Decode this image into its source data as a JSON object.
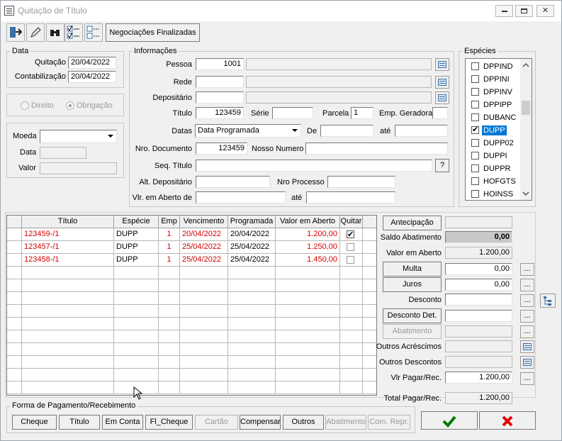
{
  "window": {
    "title": "Quitação de Título",
    "min": "▭",
    "max": "▭",
    "close": "✕"
  },
  "toolbar": {
    "negociacoes_label": "Negociações Finalizadas"
  },
  "data_group": {
    "title": "Data",
    "quitacao_label": "Quitação",
    "quitacao_value": "20/04/2022",
    "contabilizacao_label": "Contabilização",
    "contabilizacao_value": "20/04/2022"
  },
  "direito_group": {
    "direito_label": "Direito",
    "obrigacao_label": "Obrigação"
  },
  "moeda_group": {
    "moeda_label": "Moeda",
    "data_label": "Data",
    "valor_label": "Valor"
  },
  "informacoes": {
    "title": "Informações",
    "pessoa_label": "Pessoa",
    "pessoa_value": "1001",
    "rede_label": "Rede",
    "depositario_label": "Depositário",
    "titulo_label": "Título",
    "titulo_value": "123459",
    "serie_label": "Série",
    "parcela_label": "Parcela",
    "parcela_value": "1",
    "emp_geradora_label": "Emp. Geradora",
    "datas_label": "Datas",
    "datas_value": "Data Programada",
    "de_label": "De",
    "ate_label": "até",
    "nro_documento_label": "Nro. Documento",
    "nro_documento_value": "123459",
    "nosso_numero_label": "Nosso Numero",
    "seq_titulo_label": "Seq. Título",
    "seq_button": "?",
    "alt_depositario_label": "Alt. Depositário",
    "nro_processo_label": "Nro Processo",
    "vlr_aberto_label": "Vlr. em Aberto de",
    "vlr_ate_label": "até"
  },
  "especies": {
    "title": "Espécies",
    "items": [
      {
        "label": "DPPIND",
        "checked": false
      },
      {
        "label": "DPPINI",
        "checked": false
      },
      {
        "label": "DPPINV",
        "checked": false
      },
      {
        "label": "DPPIPP",
        "checked": false
      },
      {
        "label": "DUBANC",
        "checked": false
      },
      {
        "label": "DUPP",
        "checked": true
      },
      {
        "label": "DUPP02",
        "checked": false
      },
      {
        "label": "DUPPI",
        "checked": false
      },
      {
        "label": "DUPPR",
        "checked": false
      },
      {
        "label": "HOFGTS",
        "checked": false
      },
      {
        "label": "HOINSS",
        "checked": false
      }
    ]
  },
  "table": {
    "columns": [
      "Título",
      "Espécie",
      "Emp",
      "Vencimento",
      "Programada",
      "Valor em Aberto",
      "Quitar"
    ],
    "rows": [
      {
        "titulo": "123459-/1",
        "especie": "DUPP",
        "emp": "1",
        "vencimento": "20/04/2022",
        "programada": "20/04/2022",
        "valor": "1.200,00",
        "quitar": true
      },
      {
        "titulo": "123457-/1",
        "especie": "DUPP",
        "emp": "1",
        "vencimento": "25/04/2022",
        "programada": "25/04/2022",
        "valor": "1.250,00",
        "quitar": false
      },
      {
        "titulo": "123458-/1",
        "especie": "DUPP",
        "emp": "1",
        "vencimento": "25/04/2022",
        "programada": "25/04/2022",
        "valor": "1.450,00",
        "quitar": false
      }
    ]
  },
  "right_panel": {
    "antecipacao": "Antecipação",
    "saldo_abatimento_label": "Saldo Abatimento",
    "saldo_abatimento_value": "0,00",
    "valor_aberto_label": "Valor em Aberto",
    "valor_aberto_value": "1.200,00",
    "multa": "Multa",
    "multa_value": "0,00",
    "juros": "Juros",
    "juros_value": "0,00",
    "desconto_label": "Desconto",
    "desconto_det": "Desconto Det.",
    "abatimento": "Abatimento",
    "outros_acrescimos_label": "Outros Acréscimos",
    "outros_descontos_label": "Outros Descontos",
    "vlr_pagar_label": "Vlr Pagar/Rec.",
    "vlr_pagar_value": "1.200,00",
    "total_label": "Total Pagar/Rec.",
    "total_value": "1.200,00",
    "dots": "..."
  },
  "forma_pagamento": {
    "title": "Forma de Pagamento/Recebimento",
    "buttons": [
      "Cheque",
      "Título",
      "Em Conta",
      "Fl_Cheque",
      "Cartão",
      "Compensar",
      "Outros",
      "Abatimento",
      "Com. Repr."
    ]
  },
  "colors": {
    "confirm": "#007a00",
    "cancel": "#e00000",
    "red_text": "#d40000",
    "selection": "#0078d7"
  }
}
